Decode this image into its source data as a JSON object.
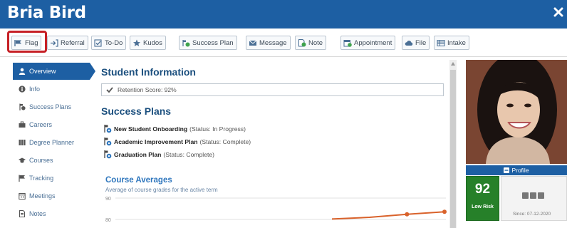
{
  "window": {
    "title": "Bria Bird",
    "close_icon": "close-icon"
  },
  "toolbar": {
    "buttons": [
      {
        "label": "Flag",
        "icon": "flag-icon"
      },
      {
        "label": "Referral",
        "icon": "referral-icon"
      },
      {
        "label": "To-Do",
        "icon": "checkbox-icon"
      },
      {
        "label": "Kudos",
        "icon": "star-icon"
      },
      {
        "label": "Success Plan",
        "icon": "success-plan-icon"
      },
      {
        "label": "Message",
        "icon": "envelope-icon"
      },
      {
        "label": "Note",
        "icon": "note-add-icon"
      },
      {
        "label": "Appointment",
        "icon": "calendar-add-icon"
      },
      {
        "label": "File",
        "icon": "cloud-upload-icon"
      },
      {
        "label": "Intake",
        "icon": "table-icon"
      }
    ],
    "highlight_color": "#c62026"
  },
  "sidebar": {
    "items": [
      {
        "label": "Overview",
        "icon": "user-icon",
        "active": true
      },
      {
        "label": "Info",
        "icon": "info-icon"
      },
      {
        "label": "Success Plans",
        "icon": "success-plan-icon"
      },
      {
        "label": "Careers",
        "icon": "briefcase-icon"
      },
      {
        "label": "Degree Planner",
        "icon": "columns-icon"
      },
      {
        "label": "Courses",
        "icon": "graduation-cap-icon"
      },
      {
        "label": "Tracking",
        "icon": "flag-icon"
      },
      {
        "label": "Meetings",
        "icon": "calendar-icon"
      },
      {
        "label": "Notes",
        "icon": "note-icon"
      }
    ]
  },
  "main": {
    "student_info_heading": "Student Information",
    "retention": "Retention Score: 92%",
    "success_plans_heading": "Success Plans",
    "plans": [
      {
        "name": "New Student Onboarding",
        "status": "(Status: In Progress)"
      },
      {
        "name": "Academic Improvement Plan",
        "status": "(Status: Complete)"
      },
      {
        "name": "Graduation Plan",
        "status": "(Status: Complete)"
      }
    ],
    "course_averages_title": "Course Averages",
    "course_averages_subtitle": "Average of course grades for the active term"
  },
  "chart_data": {
    "type": "line",
    "title": "Course Averages",
    "subtitle": "Average of course grades for the active term",
    "y_tick_labels": [
      "90",
      "80"
    ],
    "ylim": [
      80,
      90
    ],
    "grid": true,
    "series": [
      {
        "values": [
          80.2,
          81.0,
          82.4,
          83.6
        ],
        "color": "#d9622b"
      }
    ]
  },
  "profile": {
    "profile_label": "Profile",
    "score": "92",
    "risk_label": "Low Risk",
    "risk_color": "#268029",
    "since": "Since: 07-12-2020",
    "accent": "#1d5fa3"
  }
}
